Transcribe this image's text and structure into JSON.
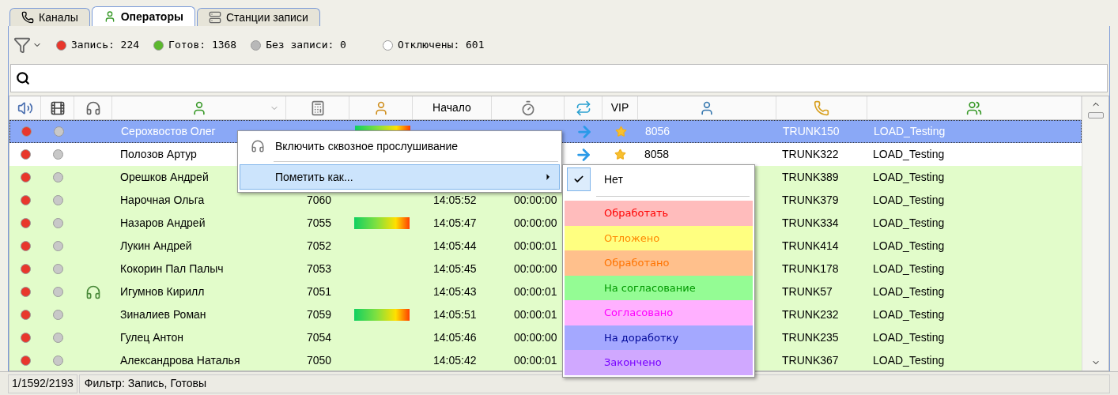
{
  "tabs": [
    {
      "label": "Каналы",
      "selected": false
    },
    {
      "label": "Операторы",
      "selected": true
    },
    {
      "label": "Станции записи",
      "selected": false
    }
  ],
  "status_filters": [
    {
      "label": "Запись: 224",
      "color": "#e8372c"
    },
    {
      "label": "Готов: 1368",
      "color": "#5cb82e"
    },
    {
      "label": "Без записи: 0",
      "color": "#b8b8b8"
    },
    {
      "label": "Отключены: 601",
      "color": "#ffffff"
    }
  ],
  "table": {
    "columns": [
      {
        "kind": "icon"
      },
      {
        "kind": "icon"
      },
      {
        "kind": "icon"
      },
      {
        "kind": "icon"
      },
      {
        "kind": "icon"
      },
      {
        "kind": "icon"
      },
      {
        "kind": "text",
        "label": "Начало"
      },
      {
        "kind": "icon"
      },
      {
        "kind": "icon"
      },
      {
        "kind": "text",
        "label": "VIP"
      },
      {
        "kind": "icon"
      },
      {
        "kind": "icon"
      },
      {
        "kind": "icon"
      }
    ],
    "rows": [
      {
        "selected": true,
        "listening": false,
        "name": "Серохвостов Олег",
        "voice_meter": true,
        "transfer": true,
        "vip": true,
        "ext": "8056",
        "trunk": "TRUNK150",
        "group": "LOAD_Testing"
      },
      {
        "selected": false,
        "listening": false,
        "name": "Полозов Артур",
        "transfer": true,
        "vip": true,
        "ext": "8058",
        "trunk": "TRUNK322",
        "group": "LOAD_Testing"
      },
      {
        "selected": false,
        "listening": false,
        "name": "Орешков Андрей",
        "trunk": "TRUNK389",
        "group": "LOAD_Testing"
      },
      {
        "selected": false,
        "listening": false,
        "name": "Нарочная Ольга",
        "number": "7060",
        "start": "14:05:52",
        "duration": "00:00:00",
        "trunk": "TRUNK379",
        "group": "LOAD_Testing"
      },
      {
        "selected": false,
        "listening": false,
        "name": "Назаров Андрей",
        "number": "7055",
        "voice_meter": true,
        "start": "14:05:47",
        "duration": "00:00:00",
        "trunk": "TRUNK334",
        "group": "LOAD_Testing"
      },
      {
        "selected": false,
        "listening": false,
        "name": "Лукин Андрей",
        "number": "7052",
        "start": "14:05:44",
        "duration": "00:00:01",
        "trunk": "TRUNK414",
        "group": "LOAD_Testing"
      },
      {
        "selected": false,
        "listening": false,
        "name": "Кокорин Пал Палыч",
        "number": "7053",
        "start": "14:05:45",
        "duration": "00:00:00",
        "trunk": "TRUNK178",
        "group": "LOAD_Testing"
      },
      {
        "selected": false,
        "listening": true,
        "name": "Игумнов Кирилл",
        "number": "7051",
        "start": "14:05:43",
        "duration": "00:00:01",
        "trunk": "TRUNK57",
        "group": "LOAD_Testing"
      },
      {
        "selected": false,
        "listening": false,
        "name": "Зиналиев Роман",
        "number": "7059",
        "voice_meter": true,
        "start": "14:05:51",
        "duration": "00:00:01",
        "trunk": "TRUNK232",
        "group": "LOAD_Testing"
      },
      {
        "selected": false,
        "listening": false,
        "name": "Гулец Антон",
        "number": "7054",
        "start": "14:05:46",
        "duration": "00:00:00",
        "trunk": "TRUNK235",
        "group": "LOAD_Testing"
      },
      {
        "selected": false,
        "listening": false,
        "name": "Александрова Наталья",
        "number": "7050",
        "start": "14:05:42",
        "duration": "00:00:01",
        "trunk": "TRUNK367",
        "group": "LOAD_Testing"
      }
    ]
  },
  "context_menu": {
    "items": [
      {
        "label": "Включить сквозное прослушивание",
        "selected": false,
        "submenu": false
      },
      {
        "label": "Пометить как...",
        "selected": true,
        "submenu": true
      }
    ]
  },
  "submenu": {
    "items": [
      {
        "label": "Нет",
        "checked": true
      },
      {
        "label": "Обработать",
        "checked": false,
        "color": "#ffbcbc"
      },
      {
        "label": "Отложено",
        "checked": false,
        "color": "#ffff80"
      },
      {
        "label": "Обработано",
        "checked": false,
        "color": "#ffc08c"
      },
      {
        "label": "На согласование",
        "checked": false,
        "color": "#94fc94"
      },
      {
        "label": "Согласовано",
        "checked": false,
        "color": "#ffb0ff"
      },
      {
        "label": "На доработку",
        "checked": false,
        "color": "#a4a8ff"
      },
      {
        "label": "Закончено",
        "checked": false,
        "color": "#d0a8ff"
      }
    ]
  },
  "status_bar": {
    "counter": "1/1592/2193",
    "filter": "Фильтр: Запись, Готовы"
  }
}
